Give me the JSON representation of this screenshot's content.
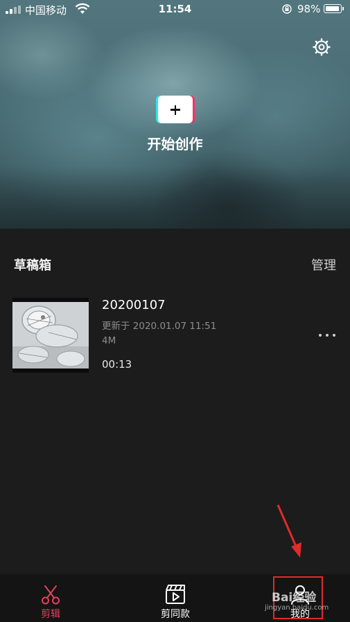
{
  "status_bar": {
    "carrier": "中国移动",
    "time": "11:54",
    "battery": "98%",
    "battery_level": 0.98
  },
  "hero": {
    "settings_icon": "settings-icon",
    "create_icon": "plus-icon",
    "create_label": "开始创作"
  },
  "drafts": {
    "title": "草稿箱",
    "manage_label": "管理",
    "items": [
      {
        "name": "20200107",
        "updated": "更新于 2020.01.07 11:51",
        "size": "4M",
        "duration": "00:13"
      }
    ]
  },
  "tabbar": {
    "tabs": [
      {
        "label": "剪辑",
        "icon": "scissors-icon",
        "active": true
      },
      {
        "label": "剪同款",
        "icon": "clapperboard-icon",
        "active": false
      },
      {
        "label": "我的",
        "icon": "person-icon",
        "active": false
      }
    ]
  },
  "annotation": {
    "highlight_color": "#e02b2b"
  },
  "watermark": {
    "text": "Bai经验",
    "url": "jingyan.baidu.com"
  },
  "colors": {
    "background": "#1c1c1c",
    "accent": "#e8405c",
    "tabbar": "#141414"
  }
}
